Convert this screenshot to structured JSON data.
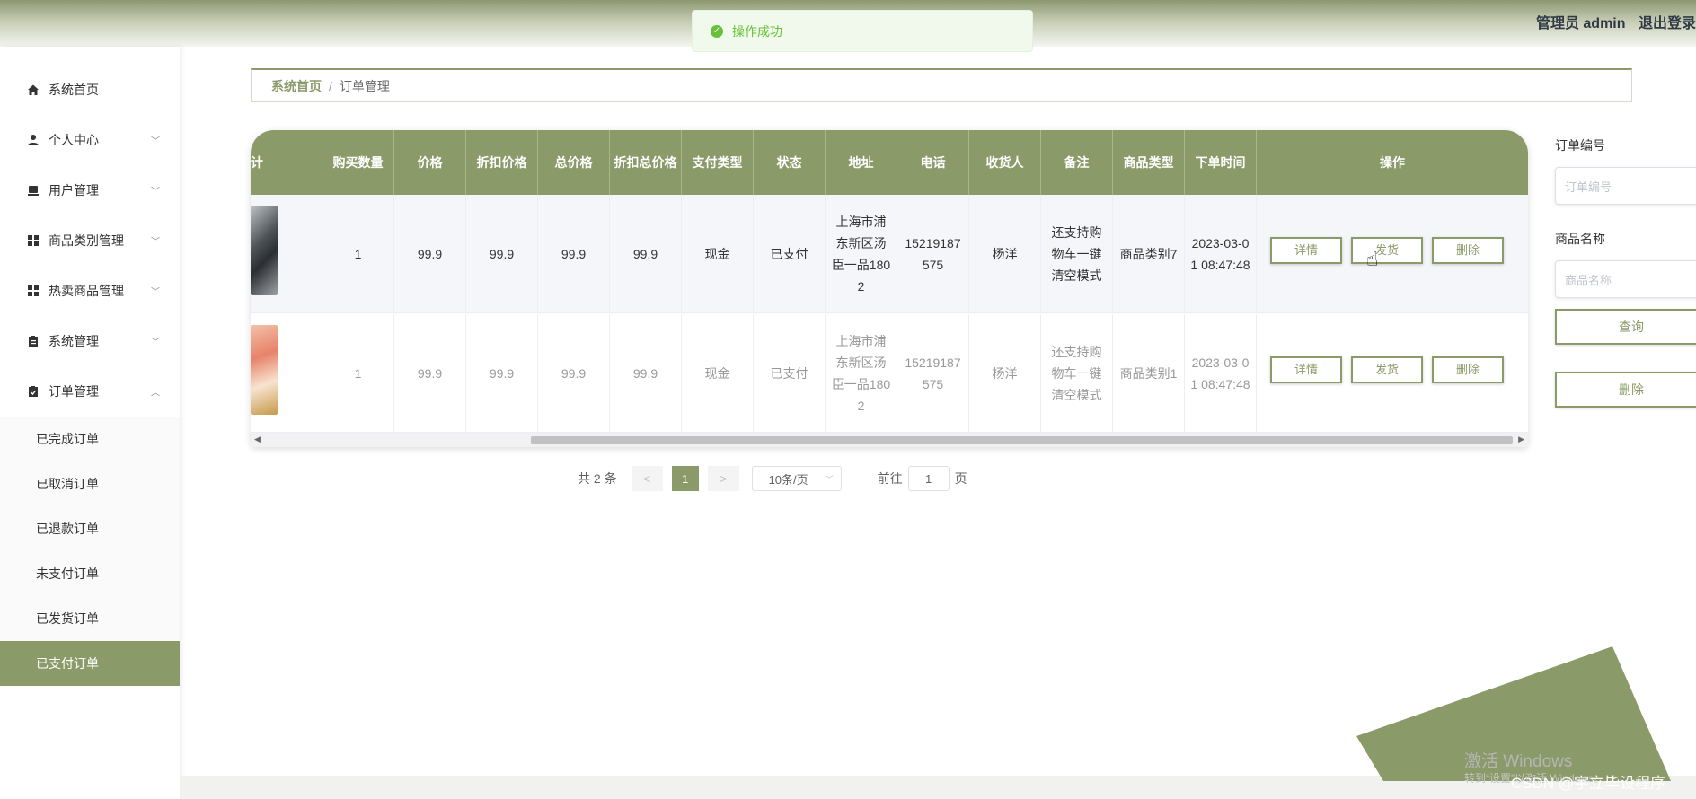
{
  "header": {
    "user_label": "管理员 admin",
    "logout_label": "退出登录"
  },
  "toast": {
    "message": "操作成功"
  },
  "sidebar": {
    "items": [
      {
        "label": "系统首页",
        "icon": "home-icon"
      },
      {
        "label": "个人中心",
        "icon": "user-icon"
      },
      {
        "label": "用户管理",
        "icon": "users-icon"
      },
      {
        "label": "商品类别管理",
        "icon": "grid-icon"
      },
      {
        "label": "热卖商品管理",
        "icon": "grid-icon"
      },
      {
        "label": "系统管理",
        "icon": "clipboard-icon"
      },
      {
        "label": "订单管理",
        "icon": "clipboard-check-icon"
      }
    ],
    "sub_items": [
      "已完成订单",
      "已取消订单",
      "已退款订单",
      "未支付订单",
      "已发货订单",
      "已支付订单"
    ],
    "active_sub": "已支付订单"
  },
  "breadcrumb": {
    "home": "系统首页",
    "separator": "/",
    "current": "订单管理"
  },
  "table": {
    "headers": {
      "partial": "计",
      "quantity": "购买数量",
      "price": "价格",
      "discount_price": "折扣价格",
      "total_price": "总价格",
      "discount_total": "折扣总价格",
      "payment_type": "支付类型",
      "status": "状态",
      "address": "地址",
      "phone": "电话",
      "receiver": "收货人",
      "note": "备注",
      "category": "商品类型",
      "order_time": "下单时间",
      "actions": "操作"
    },
    "rows": [
      {
        "quantity": "1",
        "price": "99.9",
        "discount_price": "99.9",
        "total_price": "99.9",
        "discount_total": "99.9",
        "payment_type": "现金",
        "status": "已支付",
        "address": "上海市浦东新区汤臣一品1802",
        "phone": "15219187575",
        "receiver": "杨洋",
        "note": "还支持购物车一键清空模式",
        "category": "商品类别7",
        "order_time": "2023-03-01 08:47:48"
      },
      {
        "quantity": "1",
        "price": "99.9",
        "discount_price": "99.9",
        "total_price": "99.9",
        "discount_total": "99.9",
        "payment_type": "现金",
        "status": "已支付",
        "address": "上海市浦东新区汤臣一品1802",
        "phone": "15219187575",
        "receiver": "杨洋",
        "note": "还支持购物车一键清空模式",
        "category": "商品类别1",
        "order_time": "2023-03-01 08:47:48"
      }
    ],
    "buttons": {
      "detail": "详情",
      "ship": "发货",
      "delete": "删除"
    }
  },
  "pagination": {
    "total": "共 2 条",
    "prev": "<",
    "current_page": "1",
    "next": ">",
    "page_size": "10条/页",
    "goto_prefix": "前往",
    "goto_value": "1",
    "goto_suffix": "页"
  },
  "search": {
    "order_no_label": "订单编号",
    "order_no_placeholder": "订单编号",
    "product_name_label": "商品名称",
    "product_name_placeholder": "商品名称",
    "query_button": "查询",
    "delete_button": "删除"
  },
  "watermark": {
    "line1": "激活 Windows",
    "line2": "转到“设置”以激活 Windows。",
    "csdn": "CSDN @宇立毕设程序"
  },
  "colors": {
    "accent": "#8a9a68",
    "success": "#67c23a"
  }
}
